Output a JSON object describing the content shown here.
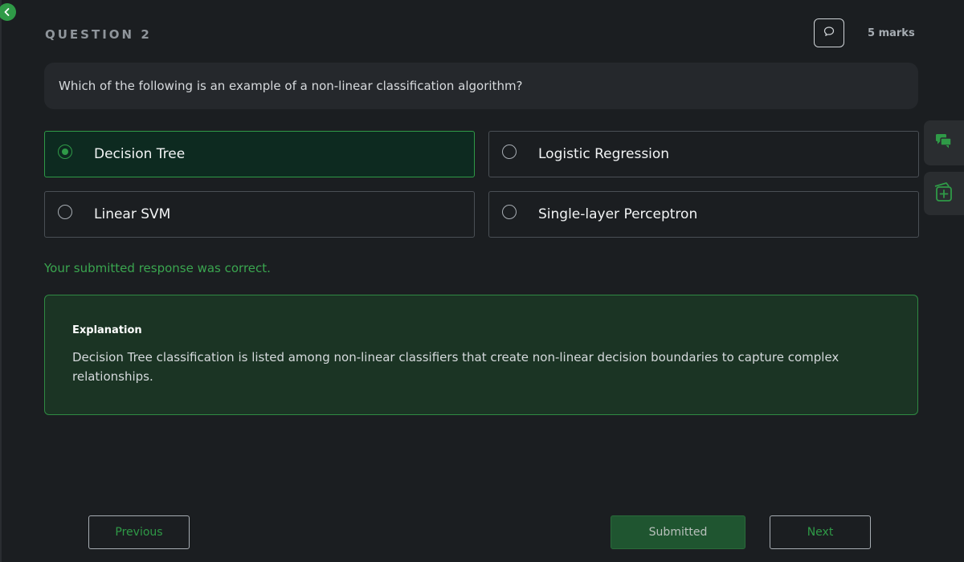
{
  "header": {
    "question_label": "QUESTION 2",
    "marks": "5 marks",
    "icons": [
      "back-icon",
      "comment-icon"
    ]
  },
  "question": {
    "text": "Which of the following is an example of a non-linear classification algorithm?"
  },
  "options": [
    {
      "label": "Decision Tree",
      "selected": true
    },
    {
      "label": "Logistic Regression",
      "selected": false
    },
    {
      "label": "Linear SVM",
      "selected": false
    },
    {
      "label": "Single-layer Perceptron",
      "selected": false
    }
  ],
  "feedback": {
    "text": "Your submitted response was correct."
  },
  "explanation": {
    "title": "Explanation",
    "text": "Decision Tree classification is listed among non-linear classifiers that create non-linear decision boundaries to capture complex relationships."
  },
  "side_tools": {
    "icons": [
      "chat-icon",
      "add-card-icon"
    ]
  },
  "navigation": {
    "previous_label": "Previous",
    "submitted_label": "Submitted",
    "next_label": "Next"
  },
  "colors": {
    "accent": "#2f9a47",
    "background": "#1b1e21",
    "selected_bg": "#0d2a20",
    "explanation_bg": "#1b3424"
  }
}
